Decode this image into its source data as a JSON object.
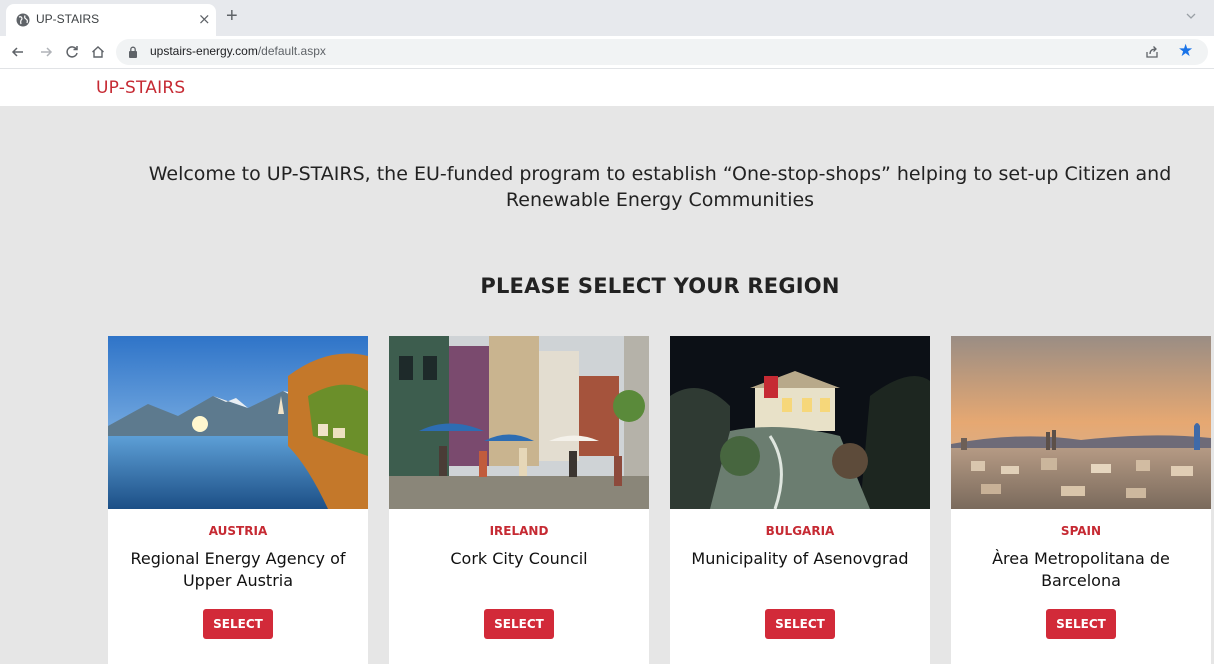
{
  "browser": {
    "tab_title": "UP-STAIRS",
    "tab_close": "×",
    "new_tab": "+",
    "url_host": "upstairs-energy.com",
    "url_path": "/default.aspx",
    "star": "★"
  },
  "site": {
    "logo": "UP-STAIRS",
    "brand_color": "#c62a33",
    "welcome": "Welcome to UP-STAIRS, the EU-funded program to establish “One-stop-shops” helping to set-up Citizen and Renewable Energy Communities",
    "heading": "PLEASE SELECT YOUR REGION"
  },
  "regions": [
    {
      "country": "AUSTRIA",
      "organization": "Regional Energy Agency of Upper Austria",
      "button": "SELECT",
      "image": "alpine-lake-village"
    },
    {
      "country": "IRELAND",
      "organization": "Cork City Council",
      "button": "SELECT",
      "image": "cafe-street"
    },
    {
      "country": "BULGARIA",
      "organization": "Municipality of Asenovgrad",
      "button": "SELECT",
      "image": "illuminated-church-night"
    },
    {
      "country": "SPAIN",
      "organization": "Àrea Metropolitana de Barcelona",
      "button": "SELECT",
      "image": "city-skyline-sunset"
    }
  ]
}
